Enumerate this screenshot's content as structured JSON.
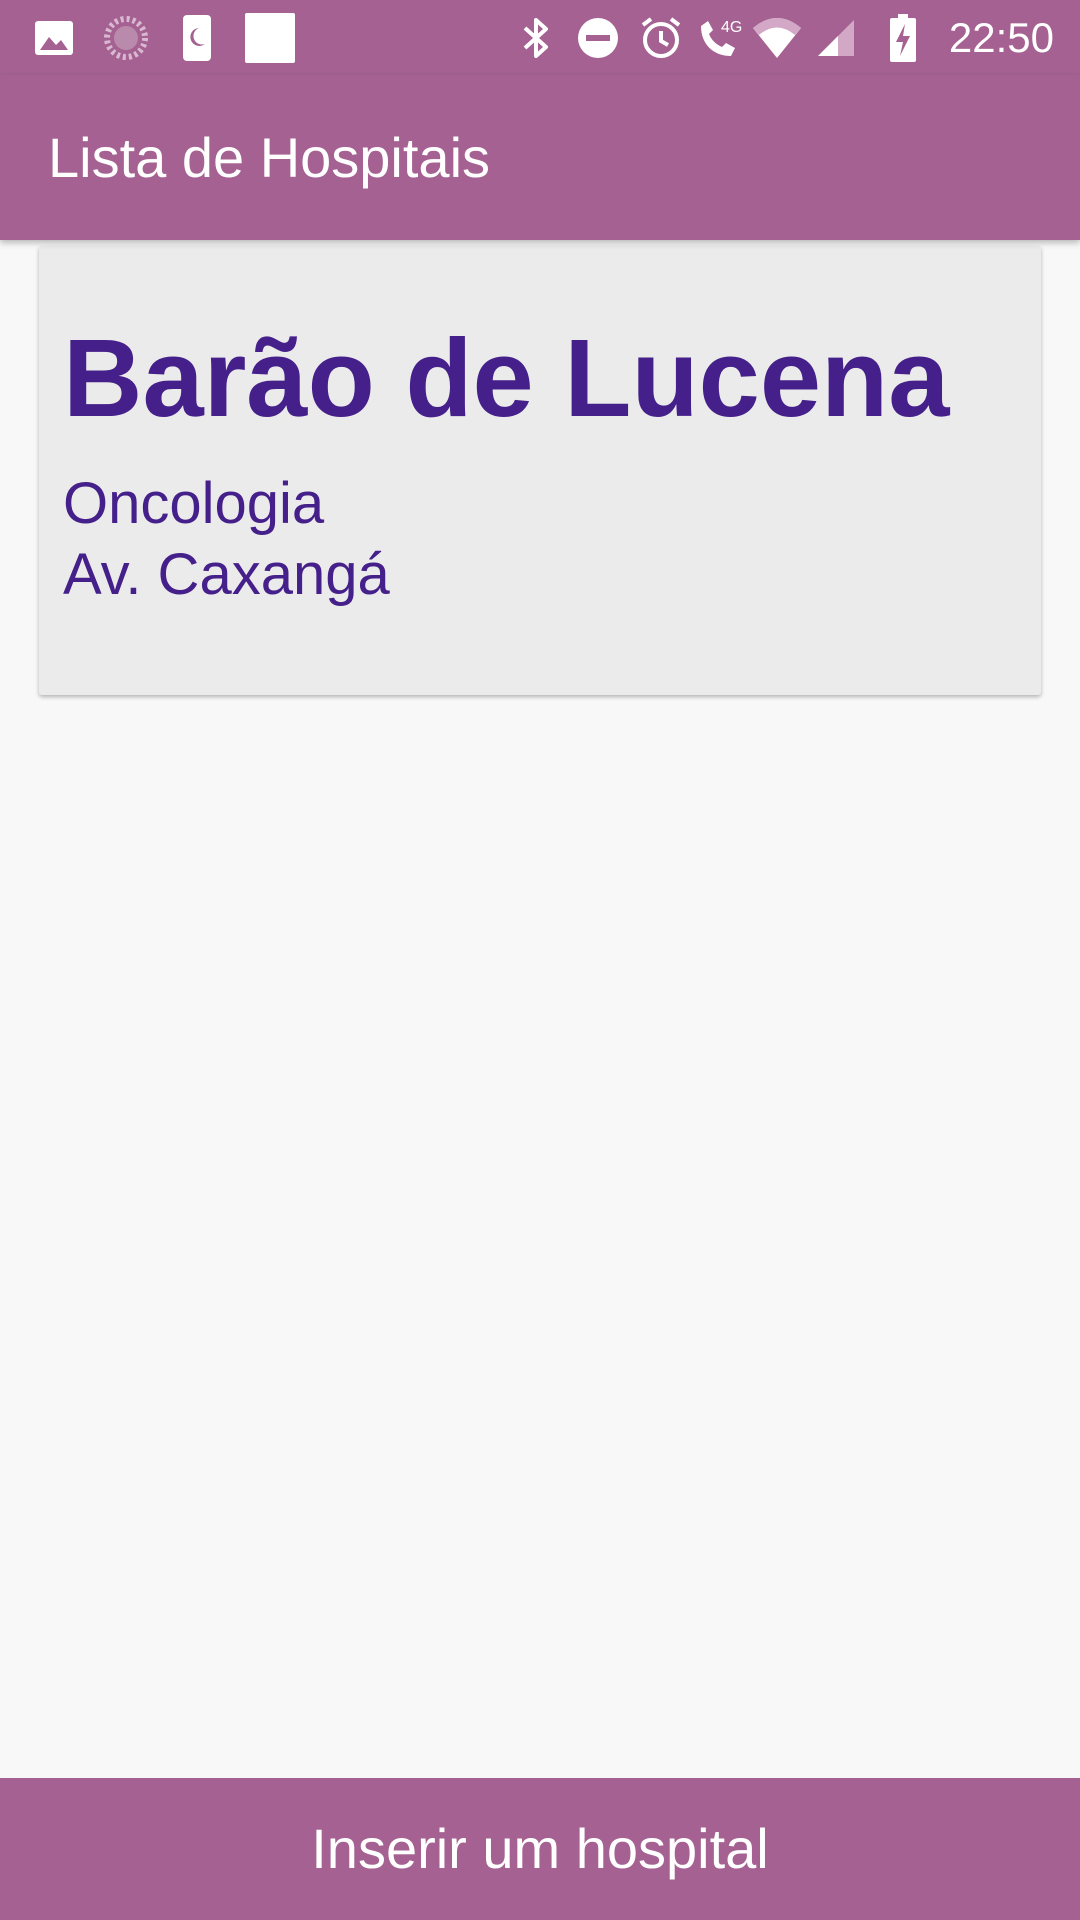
{
  "status_bar": {
    "time": "22:50",
    "network_label": "4G",
    "icons": [
      "image-icon",
      "loading-spinner-icon",
      "moon-icon",
      "blank-square-icon",
      "bluetooth-icon",
      "do-not-disturb-icon",
      "alarm-icon",
      "wifi-call-icon",
      "wifi-icon",
      "cell-signal-icon",
      "battery-charging-icon"
    ]
  },
  "app_bar": {
    "title": "Lista de Hospitais"
  },
  "hospitals": [
    {
      "name": "Barão de Lucena",
      "specialty": "Oncologia",
      "address": "Av. Caxangá"
    }
  ],
  "actions": {
    "insert_label": "Inserir um hospital"
  },
  "colors": {
    "primary": "#a46191",
    "card_text": "#45208a",
    "card_background": "#ebebeb",
    "page_background": "#f8f8f8"
  }
}
